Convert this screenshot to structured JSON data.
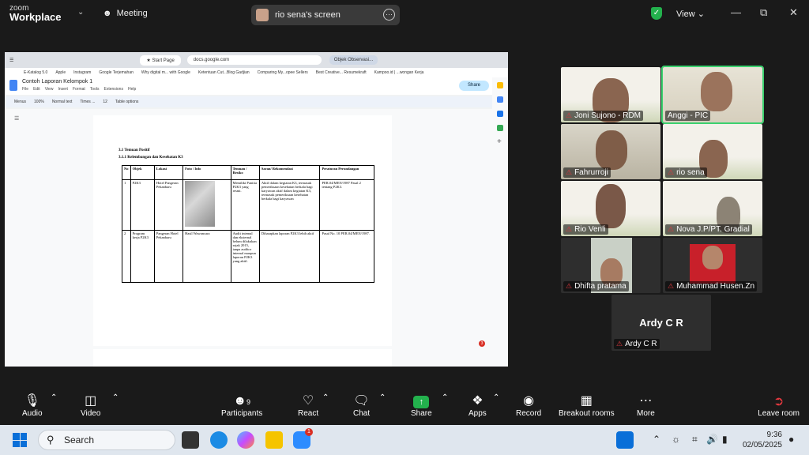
{
  "top_bar": {
    "logo_line1": "zoom",
    "logo_line2": "Workplace",
    "meeting_label": "Meeting",
    "share_title": "rio sena's screen",
    "view_label": "View"
  },
  "browser": {
    "tab_label": "Start Page",
    "url": "docs.google.com",
    "tab2_label": "Objek Observasi...",
    "bookmarks": [
      "E-Katalog 5.0",
      "Apple",
      "Instagram",
      "Google Terjemahan",
      "Why digital m... with Google",
      "Ketentuan Cut...Blog Gadjian",
      "Comparing My...opee Sellers",
      "Best Creative... Resumekraft",
      "Kampoo.id | ...wongan Kerja"
    ]
  },
  "doc": {
    "title": "Contoh Laporan Kelompok 1",
    "menu": [
      "File",
      "Edit",
      "View",
      "Insert",
      "Format",
      "Tools",
      "Extensions",
      "Help"
    ],
    "share_label": "Share",
    "account_initial": "h",
    "toolbar": [
      "Menus",
      "100%",
      "Normal text",
      "Times ...",
      "12",
      "Table options"
    ],
    "heading1": "3.1 Temuan Positif",
    "heading2": "3.1.1  Kelembangan dan Kesehatan K3",
    "table_headers": [
      "No",
      "Objek",
      "Lokasi",
      "Foto / Info",
      "Temuan / Resiko",
      "Saran/ Rekomendasi",
      "Peraturan Perundangan"
    ],
    "rows": [
      {
        "no": "1",
        "objek": "P2K3",
        "lokasi": "Hotel Pangeran Pekanbaru",
        "foto": "",
        "temuan": "Memiliki Panitia P2K3 yang resmi.",
        "saran": "Aktif dalam kegiatan K3, termasuk pemeriksaan kesehatan berkala bagi karyawan aktif dalam kegiatan K3, termasuk pemeriksaan kesehatan berkala bagi karyawan",
        "peraturan": "PER.04/MEN/1987 Pasal 2 tentang P2K3."
      },
      {
        "no": "2",
        "objek": "Program kerja P2K3",
        "lokasi": "Pangeran Hotel Pekanbaru",
        "foto": "Hasil Wawancara",
        "temuan": "Audit internal dan eksternal belum dilakukan sejak 2015, tanpa auditor internal maupun laporan P2K3 yang aktif.",
        "saran": "Diharapkan laporan P2K3 lebih aktif",
        "peraturan": "Pasal No. 10 PER.04/MEN/1987."
      }
    ],
    "comment_count": "3"
  },
  "participants_tiles": [
    {
      "name": "Joni Sujono - RDM"
    },
    {
      "name": "Anggi - PIC"
    },
    {
      "name": "Fahrurroji"
    },
    {
      "name": "rio sena"
    },
    {
      "name": "Rio Venli"
    },
    {
      "name": "Nova J.P/PT. Gradial"
    },
    {
      "name": "Dhifta pratama"
    },
    {
      "name": "Muhammad Husen.Zn"
    },
    {
      "name": "Ardy C R",
      "big_name": "Ardy C R"
    }
  ],
  "controls": {
    "audio": "Audio",
    "video": "Video",
    "participants": "Participants",
    "participants_count": "9",
    "react": "React",
    "chat": "Chat",
    "share": "Share",
    "apps": "Apps",
    "record": "Record",
    "breakout": "Breakout rooms",
    "more": "More",
    "leave": "Leave room"
  },
  "taskbar": {
    "search_placeholder": "Search",
    "time": "9:36",
    "date": "02/05/2025",
    "zoom_badge": "1"
  }
}
